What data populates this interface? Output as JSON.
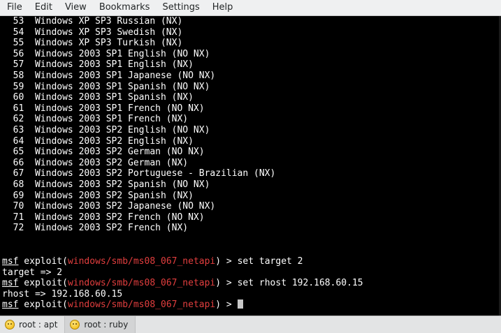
{
  "menu": [
    "File",
    "Edit",
    "View",
    "Bookmarks",
    "Settings",
    "Help"
  ],
  "targets": [
    "  53  Windows XP SP3 Russian (NX)",
    "  54  Windows XP SP3 Swedish (NX)",
    "  55  Windows XP SP3 Turkish (NX)",
    "  56  Windows 2003 SP1 English (NO NX)",
    "  57  Windows 2003 SP1 English (NX)",
    "  58  Windows 2003 SP1 Japanese (NO NX)",
    "  59  Windows 2003 SP1 Spanish (NO NX)",
    "  60  Windows 2003 SP1 Spanish (NX)",
    "  61  Windows 2003 SP1 French (NO NX)",
    "  62  Windows 2003 SP1 French (NX)",
    "  63  Windows 2003 SP2 English (NO NX)",
    "  64  Windows 2003 SP2 English (NX)",
    "  65  Windows 2003 SP2 German (NO NX)",
    "  66  Windows 2003 SP2 German (NX)",
    "  67  Windows 2003 SP2 Portuguese - Brazilian (NX)",
    "  68  Windows 2003 SP2 Spanish (NO NX)",
    "  69  Windows 2003 SP2 Spanish (NX)",
    "  70  Windows 2003 SP2 Japanese (NO NX)",
    "  71  Windows 2003 SP2 French (NO NX)",
    "  72  Windows 2003 SP2 French (NX)"
  ],
  "session": {
    "prompt_prefix": "msf",
    "prompt_exploit": " exploit(",
    "module": "windows/smb/ms08_067_netapi",
    "prompt_suffix": ") > ",
    "cmd1": "set target 2",
    "out1": "target => 2",
    "cmd2": "set rhost 192.168.60.15",
    "out2": "rhost => 192.168.60.15"
  },
  "tabs": [
    "root : apt",
    "root : ruby"
  ],
  "colors": {
    "module_red": "#e23e3e",
    "terminal_bg": "#000000"
  }
}
